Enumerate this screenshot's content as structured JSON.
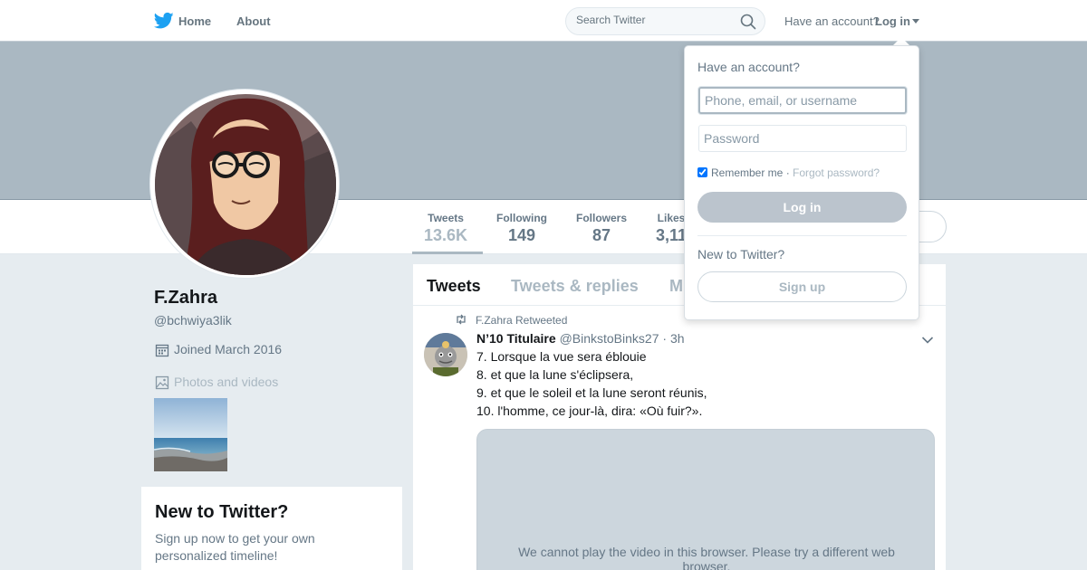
{
  "nav": {
    "home_label": "Home",
    "about_label": "About",
    "search_placeholder": "Search Twitter",
    "have_account": "Have an account?",
    "login_label": "Log in"
  },
  "profile": {
    "name": "F.Zahra",
    "handle": "@bchwiya3lik",
    "joined": "Joined March 2016",
    "photos_label": "Photos and videos",
    "stats": [
      {
        "label": "Tweets",
        "value": "13.6K"
      },
      {
        "label": "Following",
        "value": "149"
      },
      {
        "label": "Followers",
        "value": "87"
      },
      {
        "label": "Likes",
        "value": "3,11"
      }
    ]
  },
  "signup_card": {
    "title": "New to Twitter?",
    "text": "Sign up now to get your own personalized timeline!"
  },
  "timeline": {
    "tabs": [
      "Tweets",
      "Tweets & replies",
      "M"
    ],
    "tweet": {
      "retweeted_by": "F.Zahra Retweeted",
      "name": "N’10 Titulaire",
      "handle": "@BinkstoBinks27",
      "time": "· 3h",
      "lines": [
        "7. Lorsque la vue sera éblouie",
        "8. et que la lune s'éclipsera,",
        "9. et que le soleil et la lune seront réunis,",
        "10. l'homme, ce jour-là, dira: «Où fuir?»."
      ],
      "video_message": "We cannot play the video in this browser. Please try a different web browser."
    }
  },
  "login_dropdown": {
    "title": "Have an account?",
    "username_placeholder": "Phone, email, or username",
    "password_placeholder": "Password",
    "remember_label": "Remember me",
    "separator": "·",
    "forgot_label": "Forgot password?",
    "login_button": "Log in",
    "new_label": "New to Twitter?",
    "signup_button": "Sign up"
  },
  "colors": {
    "twitter_blue": "#1da1f2",
    "banner": "#aab8c2",
    "background": "#e6ecf0"
  }
}
